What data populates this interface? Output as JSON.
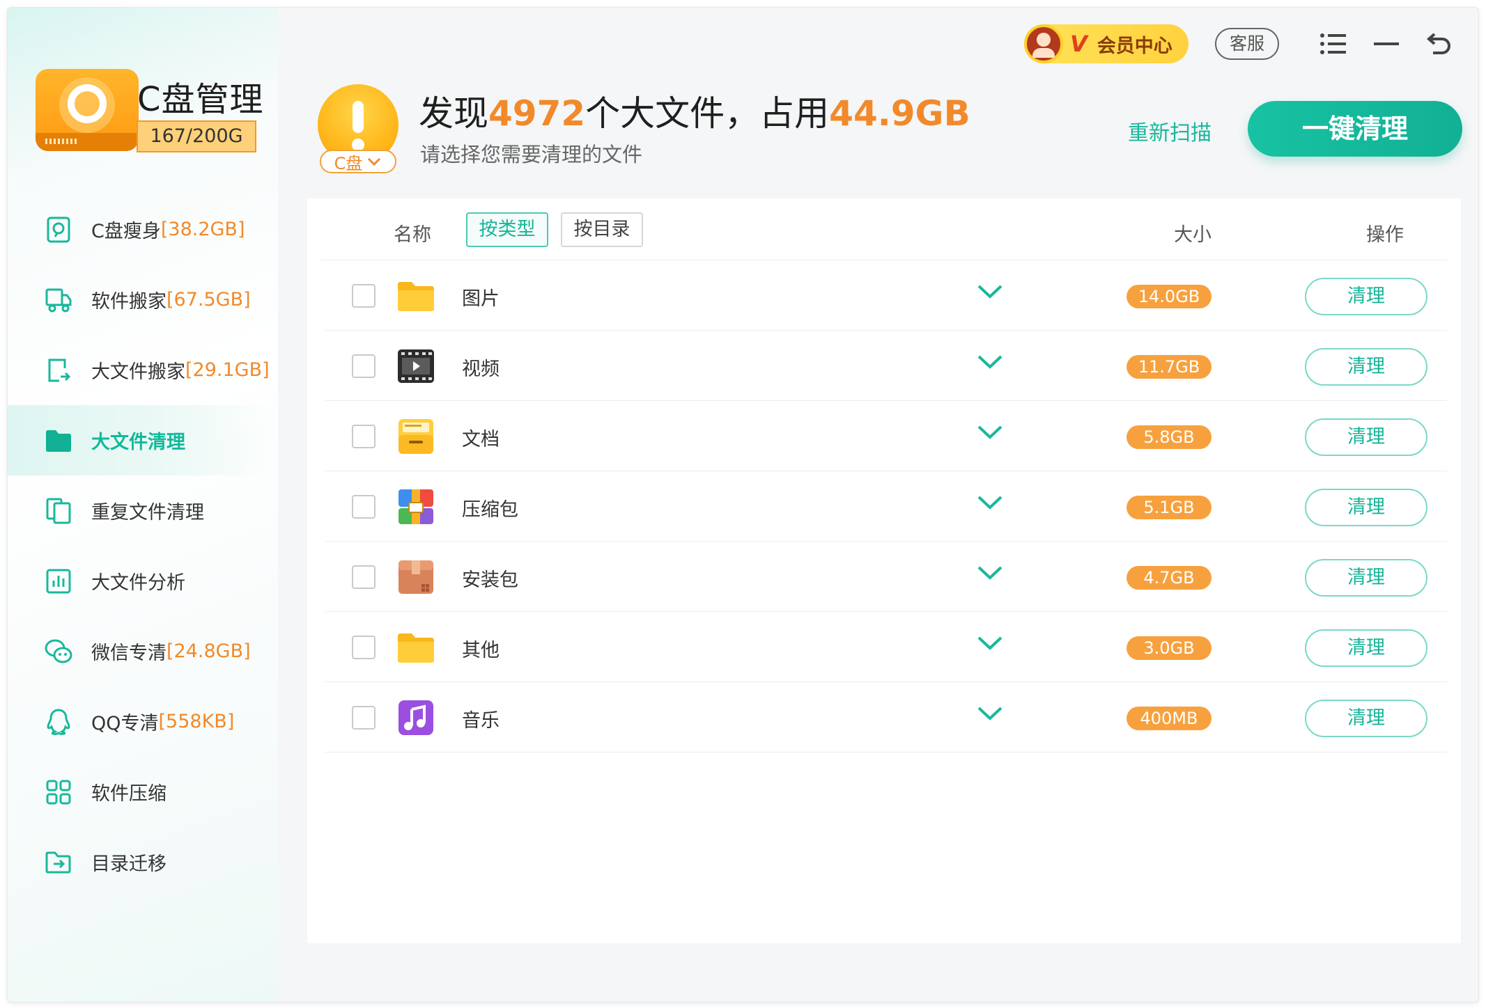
{
  "app": {
    "title": "C盘管理",
    "disk_usage": "167/200G"
  },
  "sidebar": {
    "items": [
      {
        "label": "C盘瘦身",
        "size": "[38.2GB]",
        "icon": "disk-slim-icon"
      },
      {
        "label": "软件搬家",
        "size": "[67.5GB]",
        "icon": "truck-icon"
      },
      {
        "label": "大文件搬家",
        "size": "[29.1GB]",
        "icon": "file-move-icon"
      },
      {
        "label": "大文件清理",
        "size": "",
        "icon": "folder-icon",
        "active": true
      },
      {
        "label": "重复文件清理",
        "size": "",
        "icon": "duplicate-icon"
      },
      {
        "label": "大文件分析",
        "size": "",
        "icon": "chart-icon"
      },
      {
        "label": "微信专清",
        "size": "[24.8GB]",
        "icon": "wechat-icon"
      },
      {
        "label": "QQ专清",
        "size": "[558KB]",
        "icon": "qq-icon"
      },
      {
        "label": "软件压缩",
        "size": "",
        "icon": "grid-icon"
      },
      {
        "label": "目录迁移",
        "size": "",
        "icon": "folder-arrow-icon"
      }
    ]
  },
  "topbar": {
    "vip_mark": "V",
    "vip_label": "会员中心",
    "service_label": "客服"
  },
  "header": {
    "drive_label": "C盘",
    "found_prefix": "发现",
    "file_count": "4972",
    "found_middle": "个大文件，占用",
    "total_size": "44.9GB",
    "subtitle": "请选择您需要清理的文件",
    "rescan_label": "重新扫描",
    "clean_all_label": "一键清理"
  },
  "table": {
    "col_name": "名称",
    "tab_by_type": "按类型",
    "tab_by_dir": "按目录",
    "col_size": "大小",
    "col_action": "操作",
    "clean_label": "清理",
    "rows": [
      {
        "name": "图片",
        "size": "14.0GB",
        "icon": "folder-icon"
      },
      {
        "name": "视频",
        "size": "11.7GB",
        "icon": "video-icon"
      },
      {
        "name": "文档",
        "size": "5.8GB",
        "icon": "document-icon"
      },
      {
        "name": "压缩包",
        "size": "5.1GB",
        "icon": "archive-icon"
      },
      {
        "name": "安装包",
        "size": "4.7GB",
        "icon": "package-icon"
      },
      {
        "name": "其他",
        "size": "3.0GB",
        "icon": "folder-icon"
      },
      {
        "name": "音乐",
        "size": "400MB",
        "icon": "music-icon"
      }
    ]
  },
  "colors": {
    "accent": "#12b094",
    "highlight": "#f2892a",
    "badge": "#f7a13e"
  }
}
